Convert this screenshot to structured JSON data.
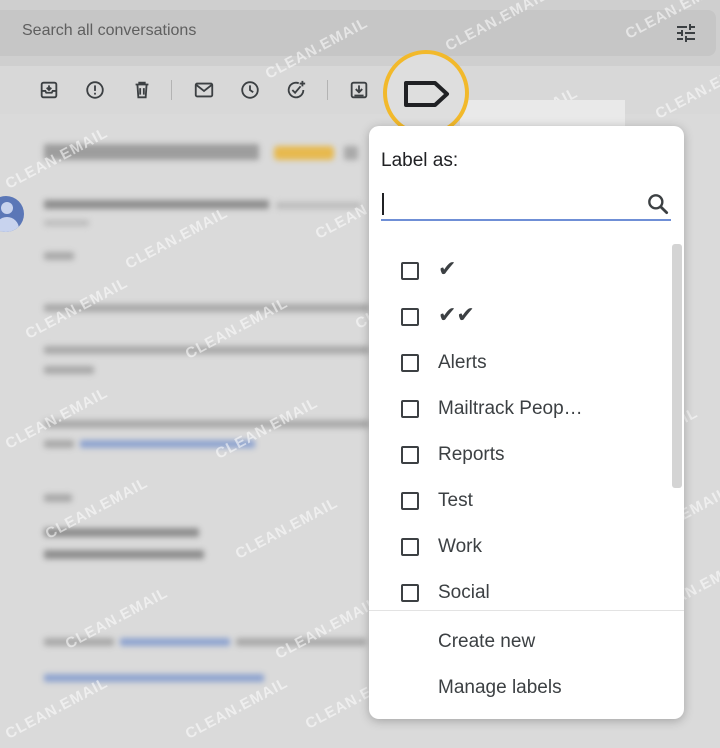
{
  "search": {
    "placeholder": "Search all conversations",
    "icon": "tune-icon"
  },
  "toolbar": {
    "icons": [
      "archive-icon",
      "report-spam-icon",
      "delete-icon",
      "mark-unread-icon",
      "snooze-icon",
      "add-to-tasks-icon",
      "move-to-icon",
      "label-icon"
    ]
  },
  "label_menu": {
    "title": "Label as:",
    "search_value": "",
    "labels": [
      "✔",
      "✔✔",
      "Alerts",
      "Mailtrack Peop…",
      "Reports",
      "Test",
      "Work",
      "Social"
    ],
    "actions": [
      "Create new",
      "Manage labels"
    ]
  },
  "watermark": "CLEAN.EMAIL",
  "colors": {
    "highlight": "#f2b92b",
    "input_underline": "#6f8fd6",
    "avatar": "#5b77b7"
  }
}
